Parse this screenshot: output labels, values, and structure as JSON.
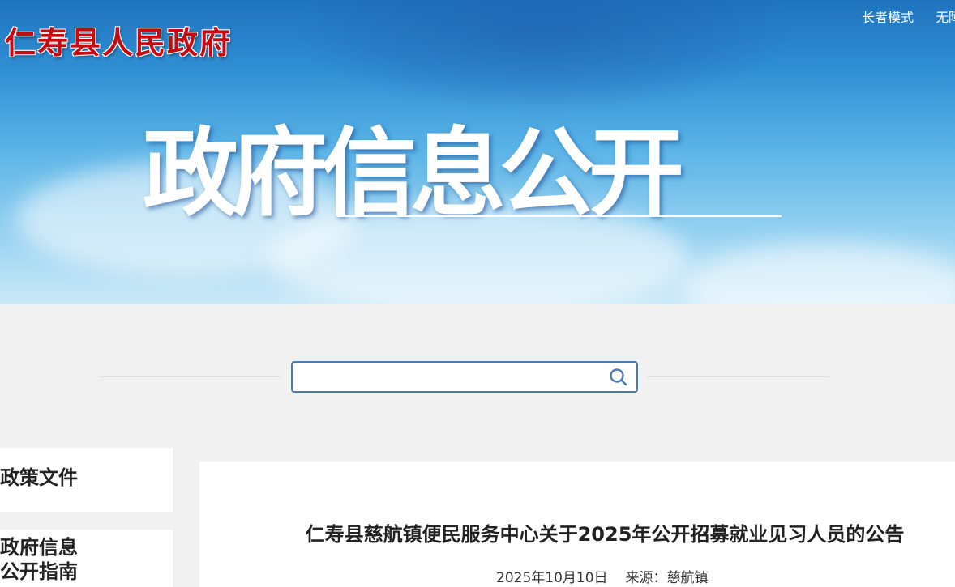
{
  "header": {
    "site_title": "仁寿县人民政府",
    "top_links": [
      "长者模式",
      "无障碍"
    ],
    "banner_heading": "政府信息公开"
  },
  "search": {
    "placeholder": "",
    "icon": "search-icon"
  },
  "sidebar": {
    "items": [
      {
        "label": "政策文件"
      },
      {
        "label_lines": [
          "政府信息",
          "公开指南"
        ]
      }
    ]
  },
  "article": {
    "title": "仁寿县慈航镇便民服务中心关于2025年公开招募就业见习人员的公告",
    "date": "2025年10月10日",
    "source_label": "来源：",
    "source": "慈航镇"
  },
  "colors": {
    "site_title": "#c8090f",
    "search_border": "#4a7bb0",
    "page_background": "#f1f1f1"
  }
}
